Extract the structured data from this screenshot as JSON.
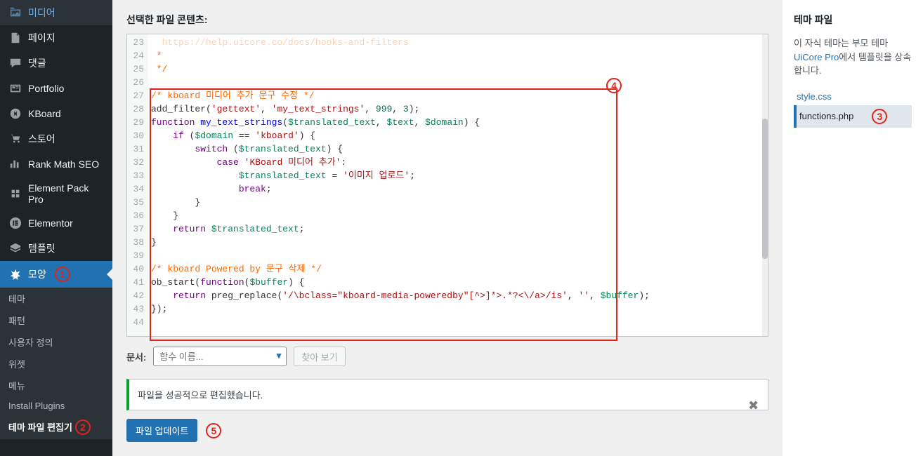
{
  "sidebar": {
    "items": [
      {
        "label": "미디어",
        "icon": "media"
      },
      {
        "label": "페이지",
        "icon": "page"
      },
      {
        "label": "댓글",
        "icon": "comment"
      },
      {
        "label": "Portfolio",
        "icon": "portfolio"
      },
      {
        "label": "KBoard",
        "icon": "kboard"
      },
      {
        "label": "스토어",
        "icon": "store"
      },
      {
        "label": "Rank Math SEO",
        "icon": "seo"
      },
      {
        "label": "Element Pack Pro",
        "icon": "ep"
      },
      {
        "label": "Elementor",
        "icon": "elementor"
      },
      {
        "label": "템플릿",
        "icon": "template"
      },
      {
        "label": "모양",
        "icon": "appearance"
      }
    ],
    "submenu": [
      {
        "label": "테마"
      },
      {
        "label": "패턴"
      },
      {
        "label": "사용자 정의"
      },
      {
        "label": "위젯"
      },
      {
        "label": "메뉴"
      },
      {
        "label": "Install Plugins"
      },
      {
        "label": "테마 파일 편집기"
      }
    ]
  },
  "main": {
    "heading": "선택한 파일 콘텐츠:",
    "doc_label": "문서:",
    "doc_placeholder": "함수 이름...",
    "lookup_btn": "찾아 보기",
    "notice": "파일을 성공적으로 편집했습니다.",
    "update_btn": "파일 업데이트"
  },
  "code": {
    "start": 23,
    "lines": [
      {
        "n": 23,
        "t": "  https://help.uicore.co/docs/hooks-and-filters",
        "cls": "cm-comment",
        "faded": true
      },
      {
        "n": 24,
        "t": " *",
        "cls": "cm-comment"
      },
      {
        "n": 25,
        "t": " */",
        "cls": "cm-comment"
      },
      {
        "n": 26,
        "t": ""
      },
      {
        "n": 27,
        "segs": [
          [
            "/* kboard 미디어 추가 문구 수정 */",
            "cm-comment"
          ]
        ]
      },
      {
        "n": 28,
        "segs": [
          [
            "add_filter",
            ""
          ],
          [
            "(",
            ""
          ],
          [
            "'gettext'",
            "cm-str"
          ],
          [
            ", ",
            ""
          ],
          [
            "'my_text_strings'",
            "cm-str"
          ],
          [
            ", ",
            ""
          ],
          [
            "999",
            "cm-num"
          ],
          [
            ", ",
            ""
          ],
          [
            "3",
            "cm-num"
          ],
          [
            ");",
            ""
          ]
        ]
      },
      {
        "n": 29,
        "segs": [
          [
            "function ",
            "cm-keyword"
          ],
          [
            "my_text_strings",
            "cm-def"
          ],
          [
            "(",
            ""
          ],
          [
            "$translated_text",
            "cm-var2"
          ],
          [
            ", ",
            ""
          ],
          [
            "$text",
            "cm-var2"
          ],
          [
            ", ",
            ""
          ],
          [
            "$domain",
            "cm-var2"
          ],
          [
            ") {",
            ""
          ]
        ]
      },
      {
        "n": 30,
        "segs": [
          [
            "    ",
            ""
          ],
          [
            "if ",
            "cm-keyword"
          ],
          [
            "(",
            ""
          ],
          [
            "$domain",
            "cm-var2"
          ],
          [
            " == ",
            ""
          ],
          [
            "'kboard'",
            "cm-str"
          ],
          [
            ") {",
            ""
          ]
        ]
      },
      {
        "n": 31,
        "segs": [
          [
            "        ",
            ""
          ],
          [
            "switch ",
            "cm-keyword"
          ],
          [
            "(",
            ""
          ],
          [
            "$translated_text",
            "cm-var2"
          ],
          [
            ") {",
            ""
          ]
        ]
      },
      {
        "n": 32,
        "segs": [
          [
            "            ",
            ""
          ],
          [
            "case ",
            "cm-keyword"
          ],
          [
            "'KBoard 미디어 추가'",
            "cm-str"
          ],
          [
            ":",
            ""
          ]
        ]
      },
      {
        "n": 33,
        "segs": [
          [
            "                ",
            ""
          ],
          [
            "$translated_text",
            "cm-var2"
          ],
          [
            " = ",
            ""
          ],
          [
            "'이미지 업로드'",
            "cm-str"
          ],
          [
            ";",
            ""
          ]
        ]
      },
      {
        "n": 34,
        "segs": [
          [
            "                ",
            ""
          ],
          [
            "break",
            "cm-keyword"
          ],
          [
            ";",
            ""
          ]
        ]
      },
      {
        "n": 35,
        "t": "        }"
      },
      {
        "n": 36,
        "t": "    }"
      },
      {
        "n": 37,
        "segs": [
          [
            "    ",
            ""
          ],
          [
            "return ",
            "cm-keyword"
          ],
          [
            "$translated_text",
            "cm-var2"
          ],
          [
            ";",
            ""
          ]
        ]
      },
      {
        "n": 38,
        "t": "}"
      },
      {
        "n": 39,
        "t": ""
      },
      {
        "n": 40,
        "segs": [
          [
            "/* kboard Powered by 문구 삭제 */",
            "cm-comment"
          ]
        ]
      },
      {
        "n": 41,
        "segs": [
          [
            "ob_start",
            ""
          ],
          [
            "(",
            ""
          ],
          [
            "function",
            "cm-keyword"
          ],
          [
            "(",
            ""
          ],
          [
            "$buffer",
            "cm-var2"
          ],
          [
            ") {",
            ""
          ]
        ]
      },
      {
        "n": 42,
        "segs": [
          [
            "    ",
            ""
          ],
          [
            "return ",
            "cm-keyword"
          ],
          [
            "preg_replace",
            ""
          ],
          [
            "(",
            ""
          ],
          [
            "'/\\bclass=\"kboard-media-poweredby\"[^>]*>.*?<\\/a>/is'",
            "cm-str"
          ],
          [
            ", ",
            ""
          ],
          [
            "''",
            "cm-str"
          ],
          [
            ", ",
            ""
          ],
          [
            "$buffer",
            "cm-var2"
          ],
          [
            ");",
            ""
          ]
        ]
      },
      {
        "n": 43,
        "t": "});"
      },
      {
        "n": 44,
        "t": ""
      }
    ]
  },
  "rpanel": {
    "title": "테마 파일",
    "desc": "이 자식 테마는 부모 테마 ",
    "link": "UiCore Pro",
    "desc2": "에서 템플릿을 상속합니다.",
    "files": [
      "style.css",
      "functions.php"
    ],
    "selected": "functions.php"
  },
  "annot": [
    "1",
    "2",
    "3",
    "4",
    "5"
  ]
}
